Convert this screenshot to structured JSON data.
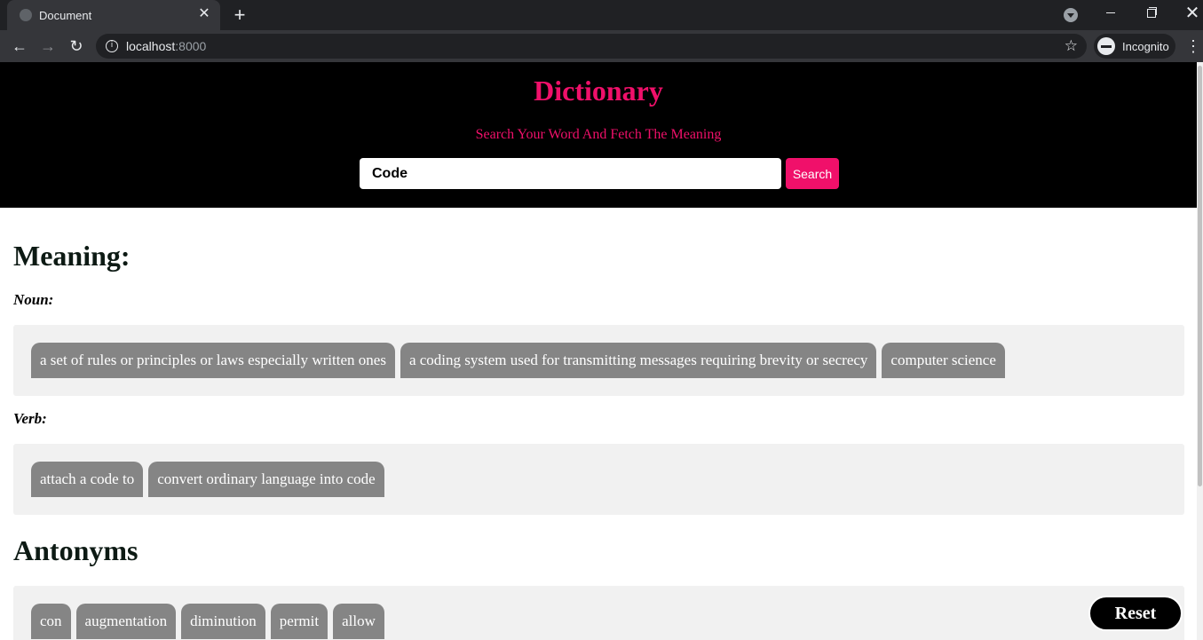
{
  "browser": {
    "tab_title": "Document",
    "new_tab": "+",
    "close_tab": "✕",
    "url_host": "localhost",
    "url_port": ":8000",
    "profile_label": "Incognito"
  },
  "header": {
    "title": "Dictionary",
    "tagline": "Search Your Word And Fetch The Meaning",
    "search_value": "Code",
    "search_button": "Search"
  },
  "meaning": {
    "heading": "Meaning:",
    "noun_label": "Noun:",
    "nouns": [
      "a set of rules or principles or laws especially written ones",
      "a coding system used for transmitting messages requiring brevity or secrecy",
      "computer science"
    ],
    "verb_label": "Verb:",
    "verbs": [
      "attach a code to",
      "convert ordinary language into code"
    ]
  },
  "antonyms": {
    "heading": "Antonyms",
    "items": [
      "con",
      "augmentation",
      "diminution",
      "permit",
      "allow"
    ]
  },
  "reset_button": "Reset"
}
